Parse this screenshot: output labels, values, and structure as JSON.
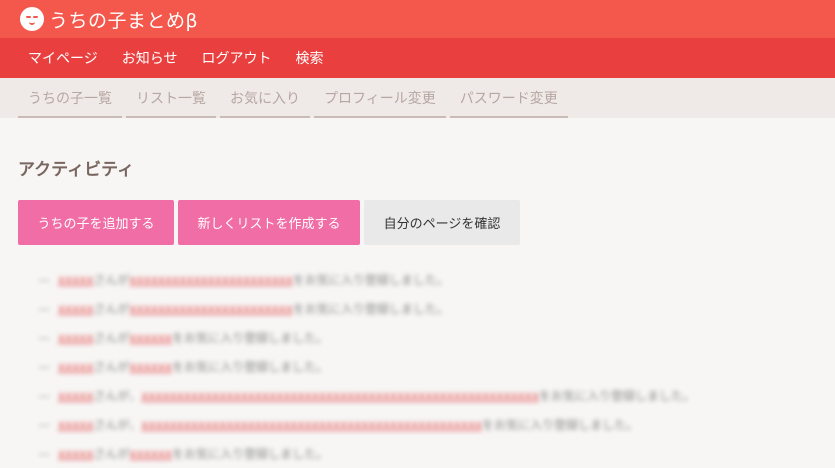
{
  "header": {
    "logo_text": "うちの子まとめβ"
  },
  "main_nav": {
    "items": [
      {
        "label": "マイページ"
      },
      {
        "label": "お知らせ"
      },
      {
        "label": "ログアウト"
      },
      {
        "label": "検索"
      }
    ]
  },
  "sub_nav": {
    "items": [
      {
        "label": "うちの子一覧"
      },
      {
        "label": "リスト一覧"
      },
      {
        "label": "お気に入り"
      },
      {
        "label": "プロフィール変更"
      },
      {
        "label": "パスワード変更"
      }
    ]
  },
  "activity": {
    "title": "アクティビティ",
    "buttons": {
      "add_child": "うちの子を追加する",
      "create_list": "新しくリストを作成する",
      "my_page": "自分のページを確認"
    },
    "entries": [
      {
        "user": "xxxxx",
        "mid": "さんが",
        "link": "xxxxxxxxxxxxxxxxxxxxxxx",
        "tail": "をお気に入り登録しました。"
      },
      {
        "user": "xxxxx",
        "mid": "さんが",
        "link": "xxxxxxxxxxxxxxxxxxxxxxx",
        "tail": "をお気に入り登録しました。"
      },
      {
        "user": "xxxxx",
        "mid": "さんが",
        "link": "xxxxxx",
        "tail": "をお気に入り登録しました。"
      },
      {
        "user": "xxxxx",
        "mid": "さんが",
        "link": "xxxxxx",
        "tail": "をお気に入り登録しました。"
      },
      {
        "user": "xxxxx",
        "mid": "さんが、",
        "link": "xxxxxxxxxxxxxxxxxxxxxxxxxxxxxxxxxxxxxxxxxxxxxxxxxxxxxxxx",
        "tail": "をお気に入り登録しました。"
      },
      {
        "user": "xxxxx",
        "mid": "さんが、",
        "link": "xxxxxxxxxxxxxxxxxxxxxxxxxxxxxxxxxxxxxxxxxxxxxxxx",
        "tail": "をお気に入り登録しました。"
      },
      {
        "user": "xxxxx",
        "mid": "さんが",
        "link": "xxxxxx",
        "tail": "をお気に入り登録しました。"
      }
    ]
  },
  "colors": {
    "header": "#f4584c",
    "main_nav": "#e9403f",
    "pink_button": "#f06da6"
  }
}
